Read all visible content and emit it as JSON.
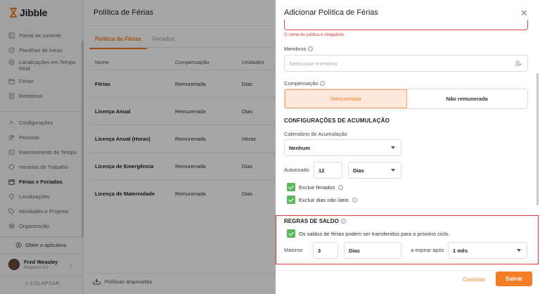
{
  "app": {
    "logo_text": "Jibble"
  },
  "sidebar": {
    "items": [
      {
        "label": "Painel de controle",
        "icon": "dashboard-icon"
      },
      {
        "label": "Planilhas de horas",
        "icon": "clock-icon"
      },
      {
        "label": "Localizações em Tempo Real",
        "icon": "location-icon"
      },
      {
        "label": "Férias",
        "icon": "calendar-icon"
      },
      {
        "label": "Relatórios",
        "icon": "report-icon"
      },
      {
        "label": "Configurações",
        "icon": "chevron-up-icon"
      },
      {
        "label": "Pessoas",
        "icon": "people-icon"
      },
      {
        "label": "Rastreamento de Tempo",
        "icon": "time-tracking-icon"
      },
      {
        "label": "Horários de Trabalho",
        "icon": "schedule-icon"
      },
      {
        "label": "Férias e Feriados",
        "icon": "calendar-icon"
      },
      {
        "label": "Localizações",
        "icon": "pin-icon"
      },
      {
        "label": "Atividades e Projetos",
        "icon": "tag-icon"
      },
      {
        "label": "Organização",
        "icon": "gear-icon"
      }
    ],
    "get_app": "Obter o aplicativo",
    "user": {
      "name": "Fred Weasley",
      "org": "Hogwarts Co"
    },
    "collapse": "COLAPSAR"
  },
  "main": {
    "title": "Política de Férias",
    "tabs": [
      "Política de Férias",
      "Feriados"
    ],
    "columns": [
      "Nome",
      "Compensação",
      "Unidades"
    ],
    "rows": [
      [
        "Férias",
        "Remunerada",
        "Dias"
      ],
      [
        "Licença Anual",
        "Remunerada",
        "Dias"
      ],
      [
        "Licença Anual (Horas)",
        "Remunerada",
        "Horas"
      ],
      [
        "Licença de Emergência",
        "Remunerada",
        "Dias"
      ],
      [
        "Licença de Maternidade",
        "Remunerada",
        "Dias"
      ]
    ],
    "archived": "Políticas arquivadas"
  },
  "panel": {
    "title": "Adicionar Política de Férias",
    "error": "O nome da política é obrigatório.",
    "members_label": "Membros",
    "members_placeholder": "Selecionar membros",
    "compensation_label": "Compensação",
    "comp_options": [
      "Remunerada",
      "Não remunerada"
    ],
    "accrual_section": "CONFIGURAÇÕES DE ACUMULAÇÃO",
    "accrual_calendar_label": "Calendário de Acumulação",
    "accrual_calendar_value": "Nenhum",
    "authorized_label": "Autorizado",
    "authorized_value": "12",
    "authorized_unit": "Dias",
    "exclude_holidays": "Excluir feriados",
    "exclude_nonworking": "Excluir dias não úteis",
    "balance_section": "REGRAS DE SALDO",
    "carryover": "Os saldos de férias podem ser transferidos para o próximo ciclo.",
    "max_label": "Máximo",
    "max_value": "3",
    "max_unit": "Dias",
    "expire_label": "a expirar após",
    "expire_value": "1 mês",
    "cancel": "Cancelar",
    "save": "Salvar"
  },
  "colors": {
    "accent": "#f47d25",
    "error": "#d9363e",
    "check": "#5cb85c"
  }
}
